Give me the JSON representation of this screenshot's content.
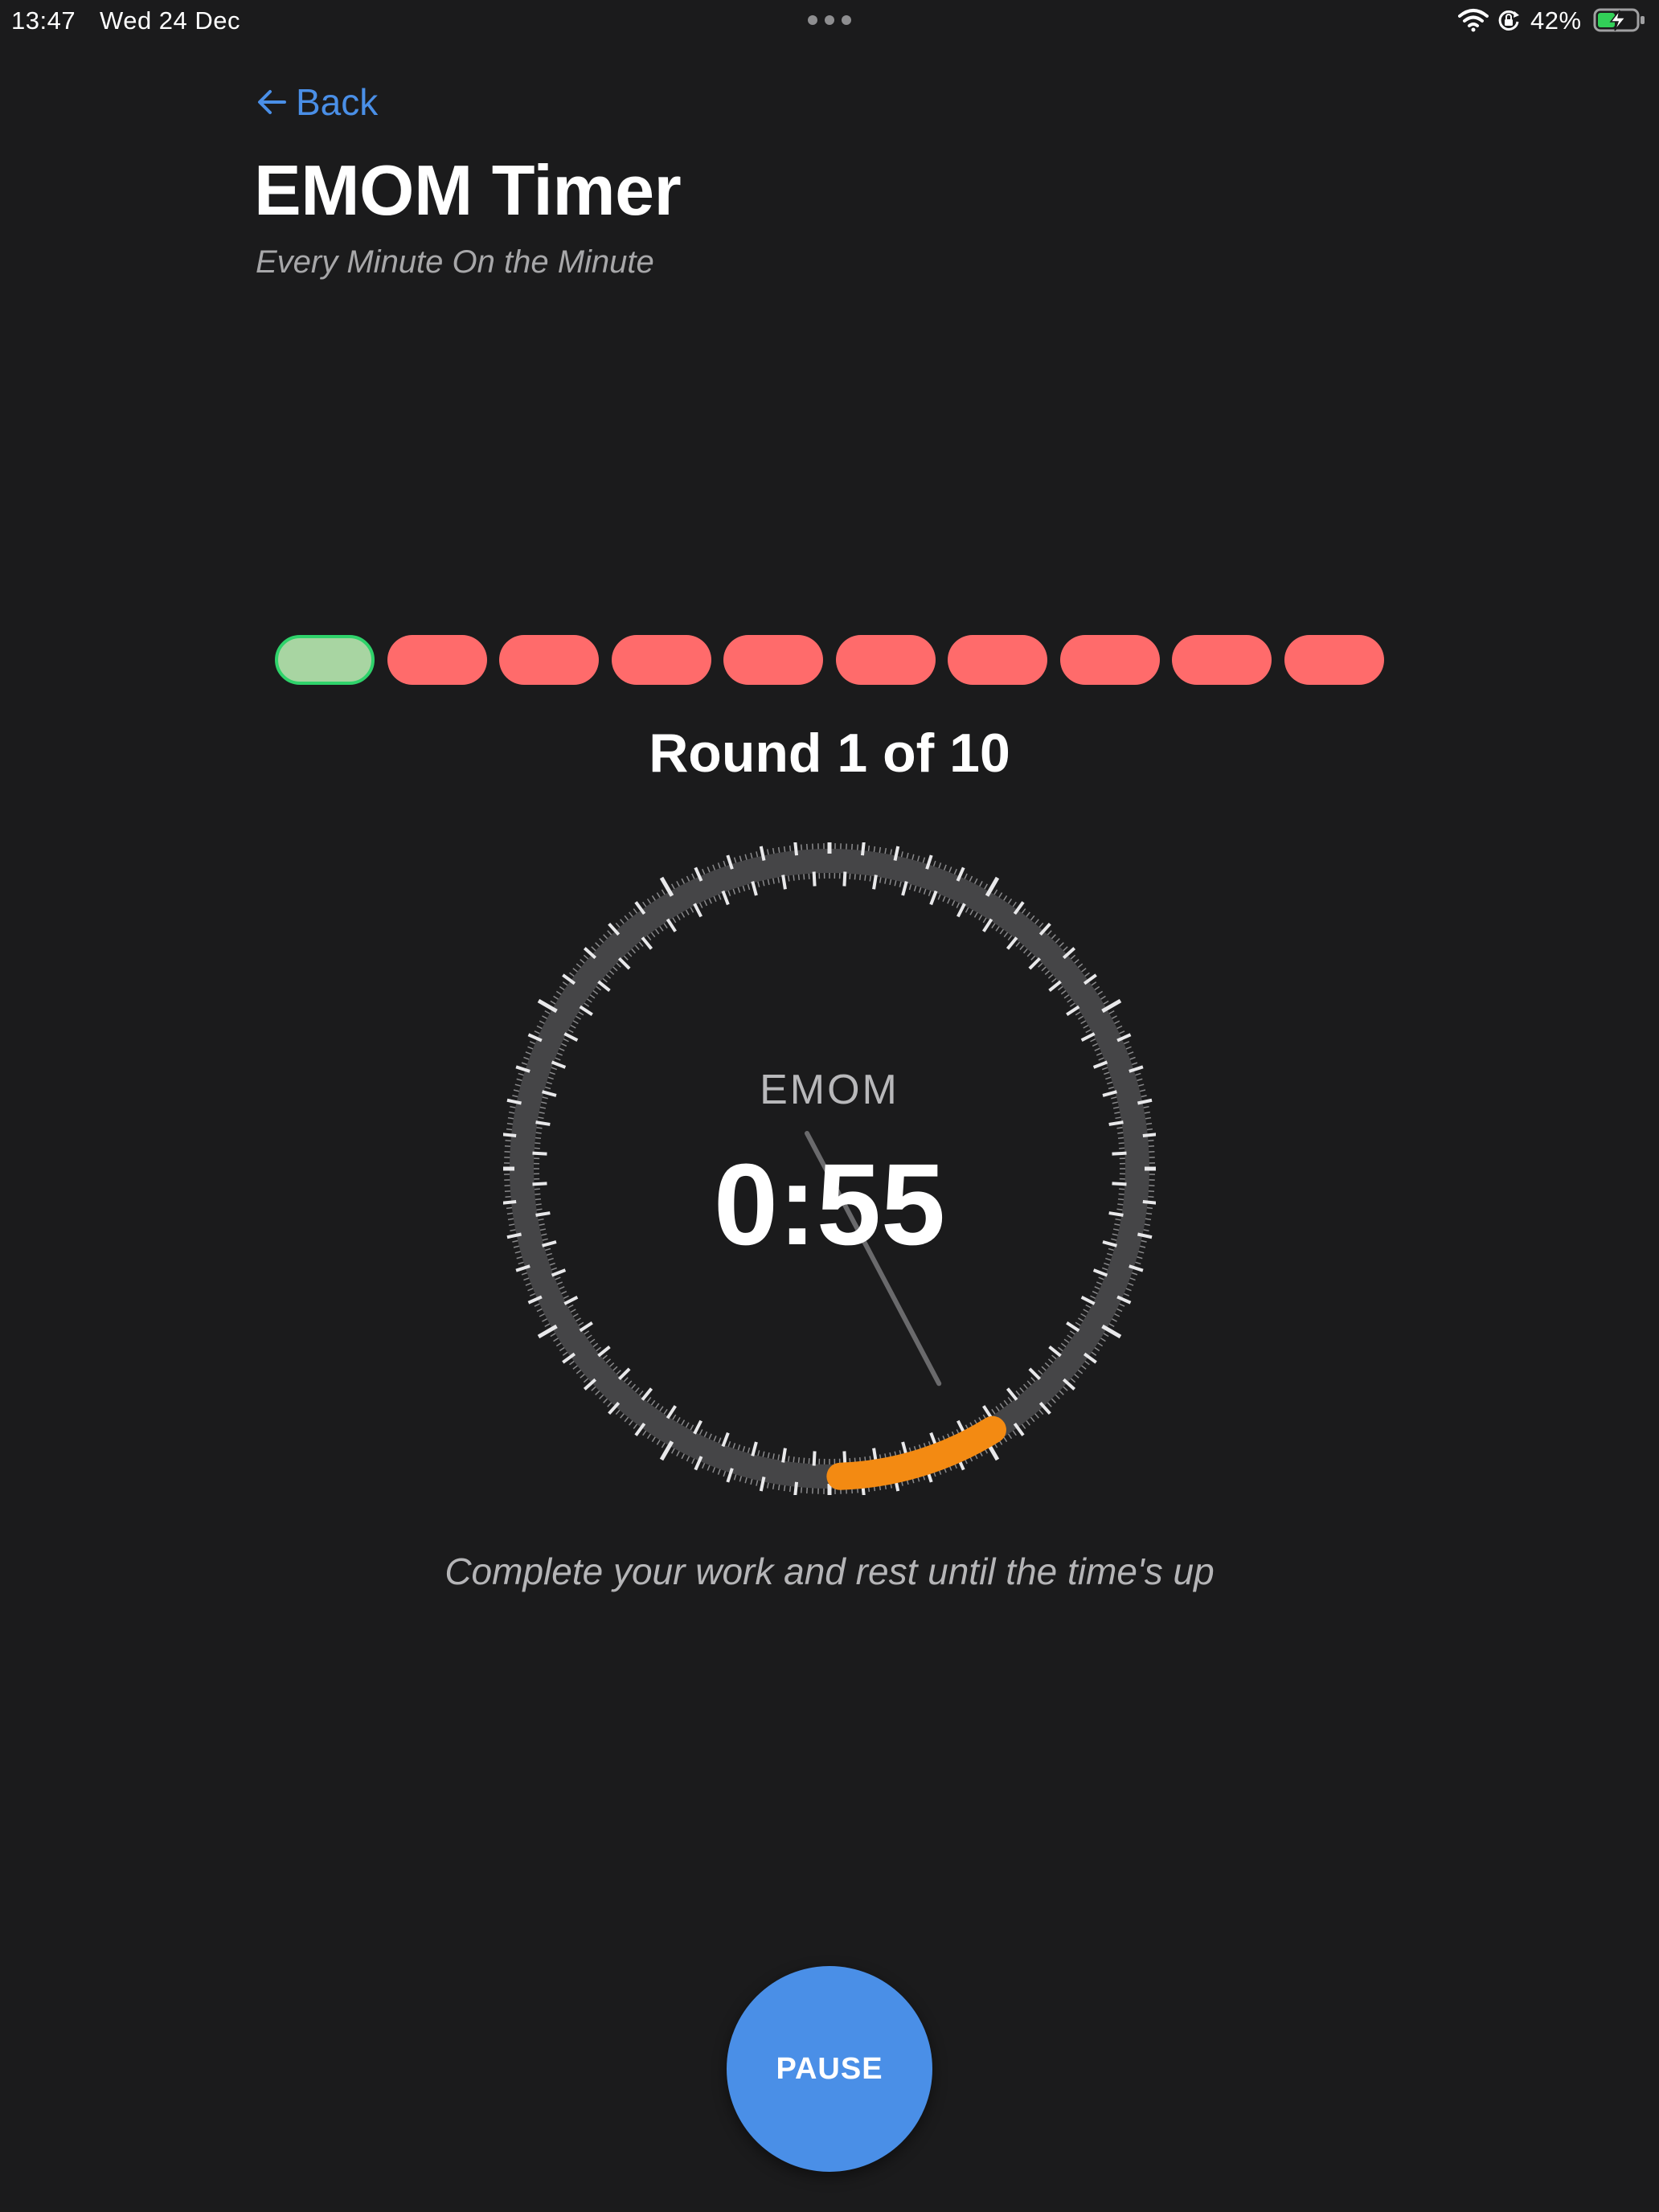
{
  "status_bar": {
    "time": "13:47",
    "date": "Wed 24 Dec",
    "battery_percent": "42%",
    "icons": [
      "more-dots-icon",
      "wifi-icon",
      "orientation-lock-icon",
      "battery-charging-icon"
    ]
  },
  "header": {
    "back_label": "Back",
    "title": "EMOM Timer",
    "subtitle": "Every Minute On the Minute"
  },
  "rounds": {
    "label": "Round 1 of 10",
    "total": 10,
    "current": 1,
    "states": [
      "active",
      "pending",
      "pending",
      "pending",
      "pending",
      "pending",
      "pending",
      "pending",
      "pending",
      "pending"
    ]
  },
  "timer": {
    "mode": "EMOM",
    "remaining": "0:55",
    "elapsed_seconds": 5,
    "period_seconds": 60,
    "hint": "Complete your work and rest until the time's up"
  },
  "controls": {
    "pause_label": "PAUSE"
  },
  "colors": {
    "background": "#1b1b1c",
    "accent_blue": "#4a8fe7",
    "round_active_fill": "#a8d5a2",
    "round_active_border": "#2fd36b",
    "round_pending": "#ff6b6b",
    "progress_orange": "#f38a12",
    "dial_track": "#454547"
  }
}
